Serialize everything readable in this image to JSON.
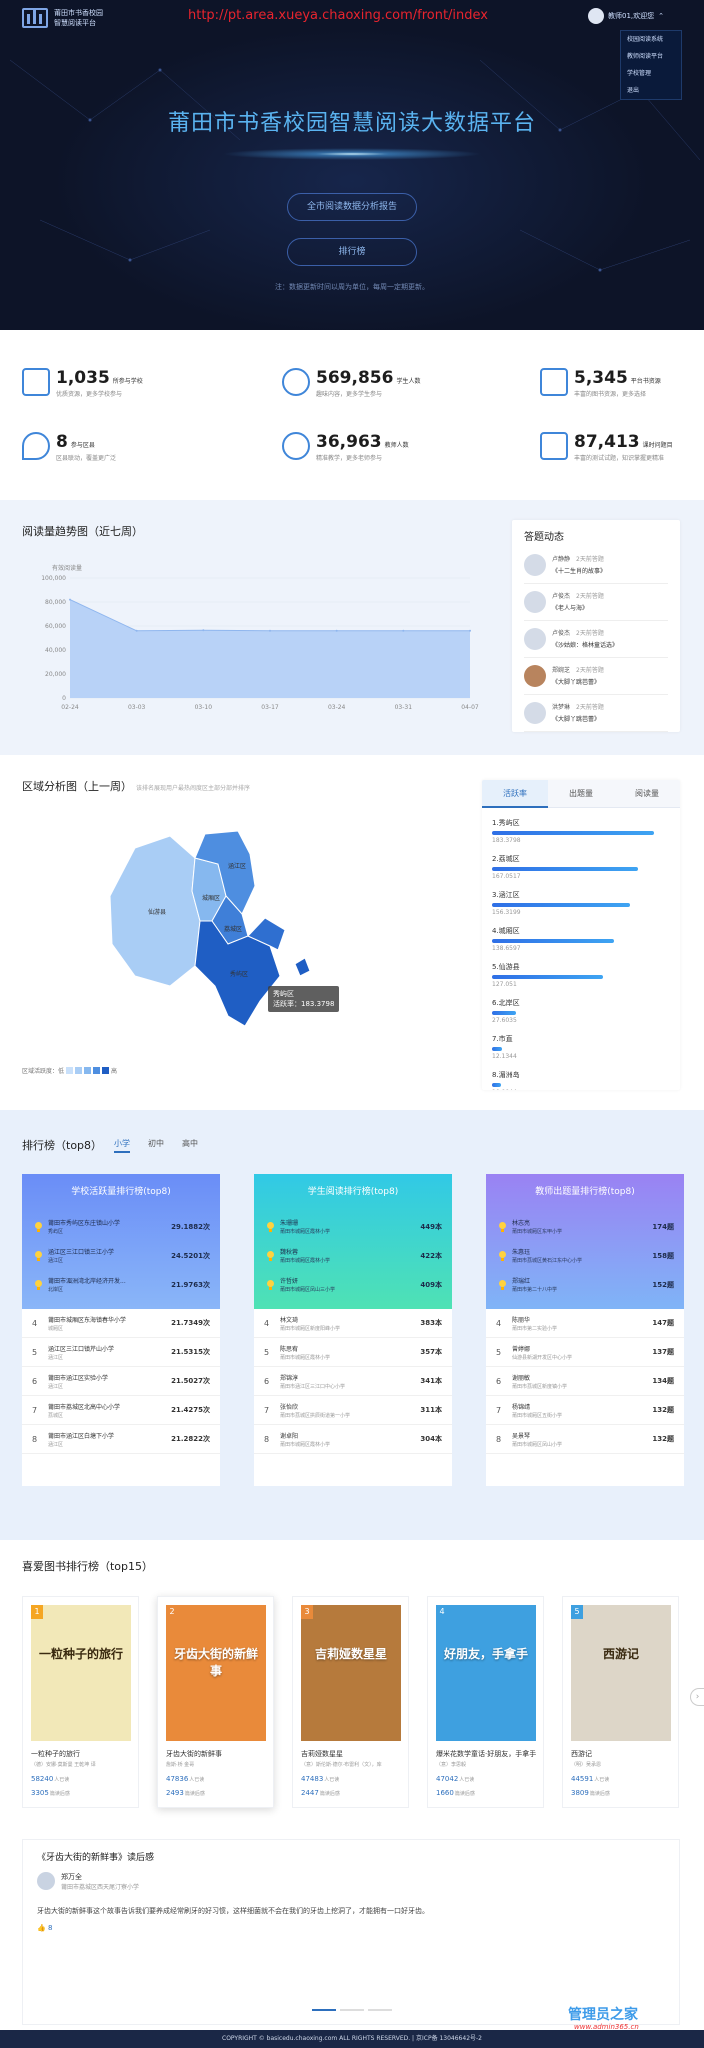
{
  "header": {
    "logo_line1": "莆田市书香校园",
    "logo_line2": "智慧阅读平台",
    "url": "http://pt.area.xueya.chaoxing.com/front/index",
    "user": "教师01,欢迎您",
    "menu": [
      "校园阅读系统",
      "教师阅读平台",
      "学校管理",
      "退出"
    ]
  },
  "hero": {
    "title": "莆田市书香校园智慧阅读大数据平台",
    "btn1": "全市阅读数据分析报告",
    "btn2": "排行榜",
    "note": "注：数据更新时间以周为单位，每周一定期更新。"
  },
  "stats": [
    {
      "num": "1,035",
      "label": "所参与学校",
      "sub": "优质资源，更多学校参与",
      "icon": "school-icon"
    },
    {
      "num": "569,856",
      "label": "学生人数",
      "sub": "趣味内容，更多学生参与",
      "icon": "student-icon"
    },
    {
      "num": "5,345",
      "label": "平台书资源",
      "sub": "丰富的图书资源，更多选择",
      "icon": "books-icon"
    },
    {
      "num": "8",
      "label": "参与区县",
      "sub": "区县联动，覆盖更广泛",
      "icon": "location-icon"
    },
    {
      "num": "36,963",
      "label": "教师人数",
      "sub": "精准教学，更多老师参与",
      "icon": "teacher-icon"
    },
    {
      "num": "87,413",
      "label": "课时问题目",
      "sub": "丰富的测试试题，知识掌握更精准",
      "icon": "quiz-icon"
    }
  ],
  "trend": {
    "title": "阅读量趋势图（近七周）"
  },
  "chart_data": {
    "type": "area",
    "title": "",
    "ylabel": "有效阅读量",
    "x": [
      "02-24",
      "03-03",
      "03-10",
      "03-17",
      "03-24",
      "03-31",
      "04-07"
    ],
    "y": [
      82000,
      56000,
      56500,
      56000,
      56000,
      56000,
      56000
    ],
    "ylim": [
      0,
      100000
    ],
    "yticks": [
      "0",
      "20,000",
      "40,000",
      "60,000",
      "80,000",
      "100,000"
    ],
    "color": "#b8d2f7"
  },
  "feed": {
    "title": "答题动态",
    "items": [
      {
        "name": "卢静静",
        "time": "2天前答题",
        "book": "《十二生肖的故事》"
      },
      {
        "name": "卢俊杰",
        "time": "2天前答题",
        "book": "《老人与海》"
      },
      {
        "name": "卢俊杰",
        "time": "2天前答题",
        "book": "《沙姑娘：格林童话选》"
      },
      {
        "name": "郑婉芝",
        "time": "2天前答题",
        "book": "《大脚丫跳芭蕾》"
      },
      {
        "name": "洪梦琳",
        "time": "2天前答题",
        "book": "《大脚丫跳芭蕾》"
      }
    ]
  },
  "area": {
    "title": "区域分析图（上一周）",
    "sub": "该排名展现用户最热闹度区主部分部并排序",
    "tabs": [
      "活跃率",
      "出题量",
      "阅读量"
    ],
    "ranking": [
      {
        "label": "1.秀屿区",
        "value": "183.3798",
        "frac": 0.95
      },
      {
        "label": "2.荔城区",
        "value": "167.0517",
        "frac": 0.86
      },
      {
        "label": "3.涵江区",
        "value": "156.3199",
        "frac": 0.81
      },
      {
        "label": "4.城厢区",
        "value": "138.6597",
        "frac": 0.72
      },
      {
        "label": "5.仙游县",
        "value": "127.051",
        "frac": 0.65
      },
      {
        "label": "6.北岸区",
        "value": "27.6035",
        "frac": 0.14
      },
      {
        "label": "7.市直",
        "value": "12.1344",
        "frac": 0.06
      },
      {
        "label": "8.湄洲岛",
        "value": "10.0044",
        "frac": 0.05
      }
    ],
    "map_labels": [
      "仙游县",
      "城厢区",
      "荔城区",
      "涵江区",
      "秀屿区",
      "北岸区"
    ],
    "tooltip_name": "秀屿区",
    "tooltip_value": "活跃率：183.3798",
    "legend_low": "区域活跃度：低",
    "legend_high": "高"
  },
  "rank": {
    "title": "排行榜（top8）",
    "levels": [
      "小学",
      "初中",
      "高中"
    ],
    "panels": [
      {
        "title": "学校活跃量排行榜(top8)",
        "rows": [
          {
            "name": "莆田市秀屿区东庄镇山小学",
            "sub": "秀屿区",
            "score": "29.1882次"
          },
          {
            "name": "涵江区三江口镇三江小学",
            "sub": "涵江区",
            "score": "24.5201次"
          },
          {
            "name": "莆田市湄洲湾北岸经济开发...",
            "sub": "北岸区",
            "score": "21.9763次"
          },
          {
            "name": "莆田市城厢区东海镇春华小学",
            "sub": "城厢区",
            "score": "21.7349次"
          },
          {
            "name": "涵江区三江口镇芹山小学",
            "sub": "涵江区",
            "score": "21.5315次"
          },
          {
            "name": "莆田市涵江区实验小学",
            "sub": "涵江区",
            "score": "21.5027次"
          },
          {
            "name": "莆田市荔城区北高中心小学",
            "sub": "荔城区",
            "score": "21.4275次"
          },
          {
            "name": "莆田市涵江区白塘下小学",
            "sub": "涵江区",
            "score": "21.2822次"
          }
        ]
      },
      {
        "title": "学生阅读排行榜(top8)",
        "rows": [
          {
            "name": "朱珊珊",
            "sub": "莆田市城厢区霞林小学",
            "score": "449本"
          },
          {
            "name": "魏秋蓉",
            "sub": "莆田市城厢区霞林小学",
            "score": "422本"
          },
          {
            "name": "许哲妍",
            "sub": "莆田市城厢区凤山三小学",
            "score": "409本"
          },
          {
            "name": "林文琦",
            "sub": "莆田市城厢区新度阳峰小学",
            "score": "383本"
          },
          {
            "name": "陈思宥",
            "sub": "莆田市城厢区霞林小学",
            "score": "357本"
          },
          {
            "name": "郑锦淳",
            "sub": "莆田市涵江区三江口中心小学",
            "score": "341本"
          },
          {
            "name": "张怡欣",
            "sub": "莆田市荔城区拱辰街道第一小学",
            "score": "311本"
          },
          {
            "name": "谢卓阳",
            "sub": "莆田市城厢区霞林小学",
            "score": "304本"
          }
        ]
      },
      {
        "title": "教师出题量排行榜(top8)",
        "rows": [
          {
            "name": "林志亮",
            "sub": "莆田市城厢区东甲小学",
            "score": "174题"
          },
          {
            "name": "朱惠珏",
            "sub": "莆田市荔城区黄石江东中心小学",
            "score": "158题"
          },
          {
            "name": "郑瑞红",
            "sub": "莆田市第二十八中学",
            "score": "152题"
          },
          {
            "name": "陈丽华",
            "sub": "莆田市第二实验小学",
            "score": "147题"
          },
          {
            "name": "曾婷娜",
            "sub": "仙游县新湖开发区中心小学",
            "score": "137题"
          },
          {
            "name": "谢丽敏",
            "sub": "莆田市荔城区新度镇小学",
            "score": "134题"
          },
          {
            "name": "杨锦靖",
            "sub": "莆田市城厢区五街小学",
            "score": "132题"
          },
          {
            "name": "吴景琴",
            "sub": "莆田市城厢区凤山小学",
            "score": "132题"
          }
        ]
      }
    ]
  },
  "books": {
    "title": "喜爱图书排行榜（top15）",
    "read_unit": "人已读",
    "review_unit": "篇读后感",
    "items": [
      {
        "rank": "1",
        "title": "一粒种子的旅行",
        "author": "（德）安娜·莫斯曼 王乾坤 译",
        "reads": "58240",
        "reviews": "3305",
        "cover_text": "一粒种子的旅行",
        "cover_bg": "#f2e8b8",
        "rank_color": "#f5a623"
      },
      {
        "rank": "2",
        "title": "牙齿大街的新鲜事",
        "author": "詹斯·桥 金哥",
        "reads": "47836",
        "reviews": "2493",
        "cover_text": "牙齿大街的新鲜事",
        "cover_bg": "#e98a3a",
        "rank_color": "#e98a3a"
      },
      {
        "rank": "3",
        "title": "吉莉娅数星星",
        "author": "（意）斯伦斯·德尔·布雷利（文），库",
        "reads": "47483",
        "reviews": "2447",
        "cover_text": "吉莉娅数星星",
        "cover_bg": "#b67a3c",
        "rank_color": "#e98a3a"
      },
      {
        "rank": "4",
        "title": "爆米花数学童话·好朋友，手拿手",
        "author": "（意）李思毅",
        "reads": "47042",
        "reviews": "1660",
        "cover_text": "好朋友，手拿手",
        "cover_bg": "#3ea0e0",
        "rank_color": "#3ea0e0"
      },
      {
        "rank": "5",
        "title": "西游记",
        "author": "（明）吴承恩",
        "reads": "44591",
        "reviews": "3809",
        "cover_text": "西游记",
        "cover_bg": "#ddd6c8",
        "rank_color": "#3ea0e0"
      }
    ]
  },
  "review": {
    "title": "《牙齿大街的新鲜事》读后感",
    "author": "郑万全",
    "school": "莆田市荔城区西天尾汀寮小学",
    "text": "牙齿大街的新鲜事这个故事告诉我们要养成经常刷牙的好习惯，这样细菌就不会在我们的牙齿上挖洞了，才能拥有一口好牙齿。",
    "likes": "8"
  },
  "footer": {
    "text": "COPYRIGHT © basicedu.chaoxing.com ALL RIGHTS RESERVED. | 京ICP备 13046642号-2",
    "watermark": "管理员之家",
    "watermark_url": "www.admin365.cn"
  }
}
